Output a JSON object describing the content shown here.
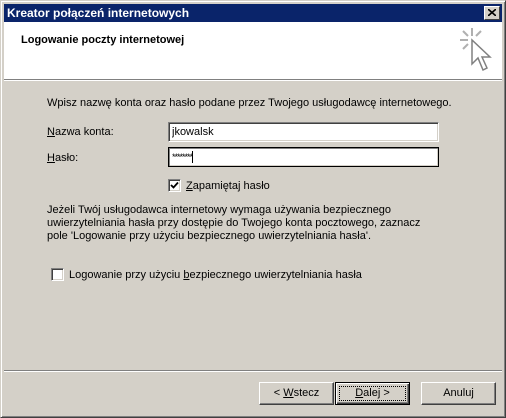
{
  "window": {
    "title": "Kreator połączeń internetowych",
    "close_icon": "close-icon"
  },
  "header": {
    "title": "Logowanie poczty internetowej",
    "icon": "wizard-cursor-sparkle-icon"
  },
  "intro": "Wpisz nazwę konta oraz hasło podane przez Twojego usługodawcę internetowego.",
  "account": {
    "label_accel": "N",
    "label_rest": "azwa konta:",
    "value": "jkowalsk"
  },
  "password": {
    "label_accel": "H",
    "label_rest": "asło:",
    "masked_value": "********"
  },
  "remember": {
    "label_accel": "Z",
    "label_rest": "apamiętaj hasło",
    "checked": true
  },
  "info": {
    "line1": "Jeżeli Twój usługodawca internetowy wymaga używania bezpiecznego",
    "line2": "uwierzytelniania hasła przy dostępie do Twojego konta pocztowego, zaznacz",
    "line3": "pole 'Logowanie przy użyciu bezpiecznego uwierzytelniania hasła'."
  },
  "spa": {
    "label_pre": "Logowanie przy użyciu ",
    "label_accel": "b",
    "label_post": "ezpiecznego uwierzytelniania hasła",
    "checked": false
  },
  "buttons": {
    "back_prefix": "< ",
    "back_accel": "W",
    "back_rest": "stecz",
    "next_accel": "D",
    "next_rest": "alej >",
    "cancel": "Anuluj"
  }
}
